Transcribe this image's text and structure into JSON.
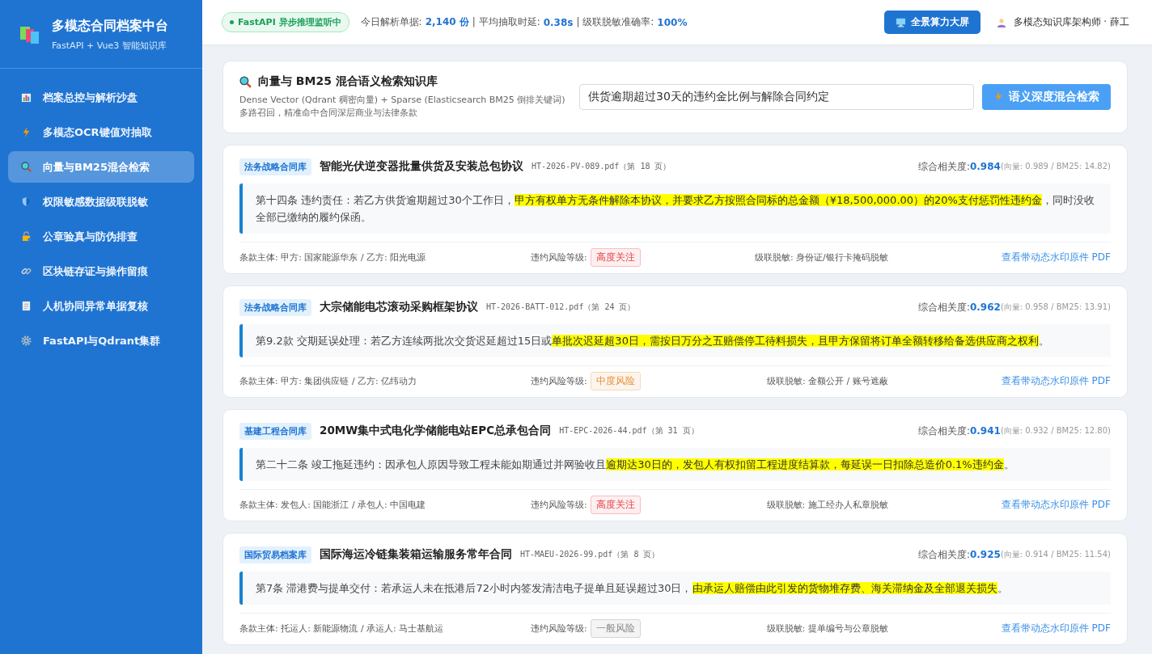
{
  "sidebar": {
    "title": "多模态合同档案中台",
    "subtitle": "FastAPI + Vue3 智能知识库",
    "items": [
      {
        "label": "档案总控与解析沙盘",
        "selected": false
      },
      {
        "label": "多模态OCR键值对抽取",
        "selected": false
      },
      {
        "label": "向量与BM25混合检索",
        "selected": true
      },
      {
        "label": "权限敏感数据级联脱敏",
        "selected": false
      },
      {
        "label": "公章验真与防伪排查",
        "selected": false
      },
      {
        "label": "区块链存证与操作留痕",
        "selected": false
      },
      {
        "label": "人机协同异常单据复核",
        "selected": false
      },
      {
        "label": "FastAPI与Qdrant集群",
        "selected": false
      }
    ]
  },
  "topbar": {
    "status_badge": "FastAPI 异步推理监听中",
    "stats": [
      {
        "label": "今日解析单据:",
        "value": "2,140 份"
      },
      {
        "label": "| 平均抽取时延:",
        "value": "0.38s"
      },
      {
        "label": "| 级联脱敏准确率:",
        "value": "100%"
      }
    ],
    "dashboard_button": "全景算力大屏",
    "user": "多模态知识库架构师 · 薛工"
  },
  "search_panel": {
    "title": "向量与 BM25 混合语义检索知识库",
    "description": "Dense Vector (Qdrant 稠密向量) + Sparse (Elasticsearch BM25 倒排关键词) 多路召回，精准命中合同深层商业与法律条款",
    "query": "供货逾期超过30天的违约金比例与解除合同约定",
    "search_button": "语义深度混合检索"
  },
  "results": [
    {
      "library": "法务战略合同库",
      "title": "智能光伏逆变器批量供货及安装总包协议",
      "file": "HT-2026-PV-089.pdf（第 18 页）",
      "score_label": "综合相关度:",
      "score": "0.984",
      "score_detail": "(向量: 0.989 / BM25: 14.82)",
      "clause": [
        {
          "text": "第十四条 违约责任：若乙方供货逾期超过30个工作日，",
          "highlighted": false
        },
        {
          "text": "甲方有权单方无条件解除本协议，并要求乙方按照合同标的总金额（¥18,500,000.00）的20%支付惩罚性违约金",
          "highlighted": true
        },
        {
          "text": "，同时没收全部已缴纳的履约保函。",
          "highlighted": false
        }
      ],
      "parties": "条款主体: 甲方: 国家能源华东 / 乙方: 阳光电源",
      "risk_label": "违约风险等级:",
      "risk": "高度关注",
      "color": "#e5484d",
      "masking": "级联脱敏: 身份证/银行卡掩码脱敏",
      "link": "查看带动态水印原件 PDF"
    },
    {
      "library": "法务战略合同库",
      "title": "大宗储能电芯滚动采购框架协议",
      "file": "HT-2026-BATT-012.pdf（第 24 页）",
      "score_label": "综合相关度:",
      "score": "0.962",
      "score_detail": "(向量: 0.958 / BM25: 13.91)",
      "clause": [
        {
          "text": "第9.2款 交期延误处理：若乙方连续两批次交货迟延超过15日或",
          "highlighted": false
        },
        {
          "text": "单批次迟延超30日，需按日万分之五赔偿停工待料损失，且甲方保留将订单全额转移给备选供应商之权利",
          "highlighted": true
        },
        {
          "text": "。",
          "highlighted": false
        }
      ],
      "parties": "条款主体: 甲方: 集团供应链 / 乙方: 亿纬动力",
      "risk_label": "违约风险等级:",
      "risk": "中度风险",
      "color": "#e8913a",
      "masking": "级联脱敏: 金额公开 / 账号遮蔽",
      "link": "查看带动态水印原件 PDF"
    },
    {
      "library": "基建工程合同库",
      "title": "20MW集中式电化学储能电站EPC总承包合同",
      "file": "HT-EPC-2026-44.pdf（第 31 页）",
      "score_label": "综合相关度:",
      "score": "0.941",
      "score_detail": "(向量: 0.932 / BM25: 12.80)",
      "clause": [
        {
          "text": "第二十二条 竣工拖延违约：因承包人原因导致工程未能如期通过并网验收且",
          "highlighted": false
        },
        {
          "text": "逾期达30日的，发包人有权扣留工程进度结算款，每延误一日扣除总造价0.1%违约金",
          "highlighted": true
        },
        {
          "text": "。",
          "highlighted": false
        }
      ],
      "parties": "条款主体: 发包人: 国能浙江 / 承包人: 中国电建",
      "risk_label": "违约风险等级:",
      "risk": "高度关注",
      "color": "#e5484d",
      "masking": "级联脱敏: 施工经办人私章脱敏",
      "link": "查看带动态水印原件 PDF"
    },
    {
      "library": "国际贸易档案库",
      "title": "国际海运冷链集装箱运输服务常年合同",
      "file": "HT-MAEU-2026-99.pdf（第 8 页）",
      "score_label": "综合相关度:",
      "score": "0.925",
      "score_detail": "(向量: 0.914 / BM25: 11.54)",
      "clause": [
        {
          "text": "第7条 滞港费与提单交付：若承运人未在抵港后72小时内签发清洁电子提单且延误超过30日，",
          "highlighted": false
        },
        {
          "text": "由承运人赔偿由此引发的货物堆存费、海关滞纳金及全部退关损失",
          "highlighted": true
        },
        {
          "text": "。",
          "highlighted": false
        }
      ],
      "parties": "条款主体: 托运人: 新能源物流 / 承运人: 马士基航运",
      "risk_label": "违约风险等级:",
      "risk": "一般风险",
      "color": "#888888",
      "masking": "级联脱敏: 提单编号与公章脱敏",
      "link": "查看带动态水印原件 PDF"
    }
  ]
}
